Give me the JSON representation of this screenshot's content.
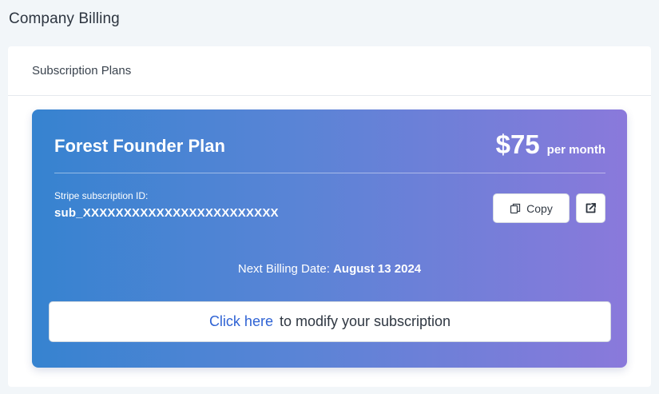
{
  "page": {
    "title": "Company Billing"
  },
  "card": {
    "header_title": "Subscription Plans"
  },
  "plan": {
    "name": "Forest Founder Plan",
    "price": "$75",
    "period": "per month",
    "subscription_label": "Stripe subscription ID:",
    "subscription_id": "sub_XXXXXXXXXXXXXXXXXXXXXXXX",
    "copy_label": "Copy",
    "next_billing_label": "Next Billing Date:",
    "next_billing_date": "August 13 2024",
    "modify_link_text": "Click here",
    "modify_text": "to modify your subscription"
  },
  "colors": {
    "gradient_start": "#3683d0",
    "gradient_end": "#8a79db",
    "link": "#2f63d4"
  },
  "icons": {
    "copy": "copy-icon",
    "external": "external-link-icon"
  }
}
